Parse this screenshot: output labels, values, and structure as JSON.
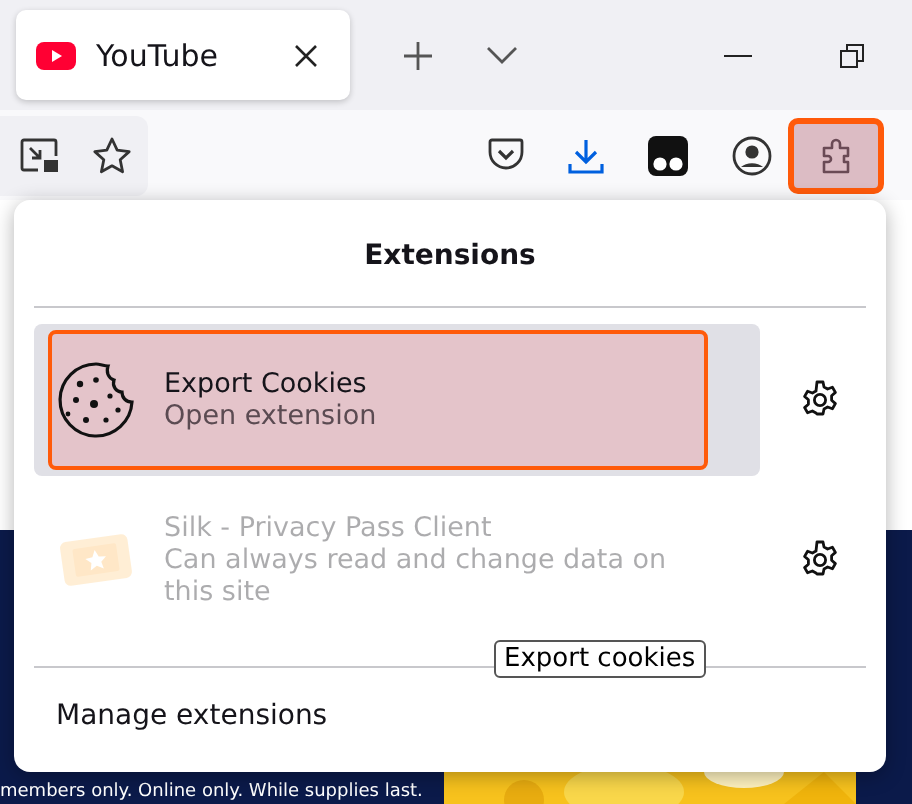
{
  "tabs": [
    {
      "title": "YouTube",
      "selected": true
    }
  ],
  "toolbar": {
    "extensions_button": {
      "highlighted": true
    }
  },
  "extensions_panel": {
    "title": "Extensions",
    "items": [
      {
        "name": "Export Cookies",
        "description": "Open extension",
        "kind": "cookie",
        "selected": true,
        "highlighted": true,
        "disabled": false
      },
      {
        "name": "Silk - Privacy Pass Client",
        "description": "Can always read and change data on this site",
        "kind": "ticket",
        "selected": false,
        "highlighted": false,
        "disabled": true
      }
    ],
    "manage_link": "Manage extensions"
  },
  "tooltip": "Export cookies",
  "page": {
    "footer_text": "members only. Online only. While supplies last."
  }
}
